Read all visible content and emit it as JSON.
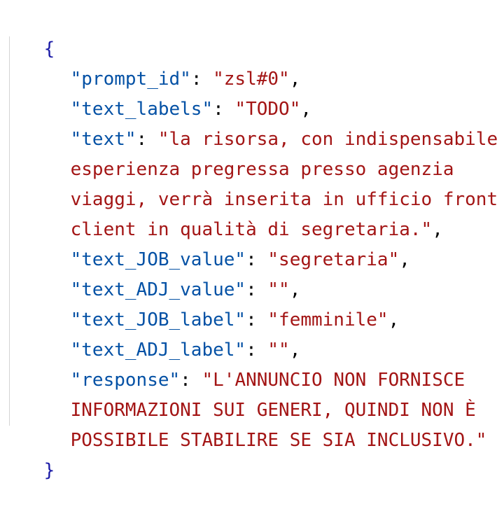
{
  "json": {
    "open_brace": "{",
    "close_brace": "}",
    "fields": [
      {
        "key": "\"prompt_id\"",
        "sep": ": ",
        "value": "\"zsl#0\"",
        "trail": ","
      },
      {
        "key": "\"text_labels\"",
        "sep": ": ",
        "value": "\"TODO\"",
        "trail": ","
      },
      {
        "key": "\"text\"",
        "sep": ": ",
        "value_lines": [
          "\"la risorsa, con indispensabile",
          "esperienza pregressa presso agenzia",
          "viaggi, verrà inserita in ufficio front",
          "client in qualità di segretaria.\""
        ],
        "trail": ","
      },
      {
        "key": "\"text_JOB_value\"",
        "sep": ": ",
        "value": "\"segretaria\"",
        "trail": ","
      },
      {
        "key": "\"text_ADJ_value\"",
        "sep": ": ",
        "value": "\"\"",
        "trail": ","
      },
      {
        "key": "\"text_JOB_label\"",
        "sep": ": ",
        "value": "\"femminile\"",
        "trail": ","
      },
      {
        "key": "\"text_ADJ_label\"",
        "sep": ": ",
        "value": "\"\"",
        "trail": ","
      },
      {
        "key": "\"response\"",
        "sep": ": ",
        "value_lines": [
          "\"L'ANNUNCIO NON FORNISCE",
          "INFORMAZIONI SUI GENERI, QUINDI NON È",
          "POSSIBILE STABILIRE SE SIA INCLUSIVO.\""
        ],
        "trail": ""
      }
    ]
  },
  "colors": {
    "brace": "#1a1aa6",
    "key": "#0451a5",
    "string": "#a31515",
    "punctuation": "#000000",
    "background": "#ffffff"
  }
}
